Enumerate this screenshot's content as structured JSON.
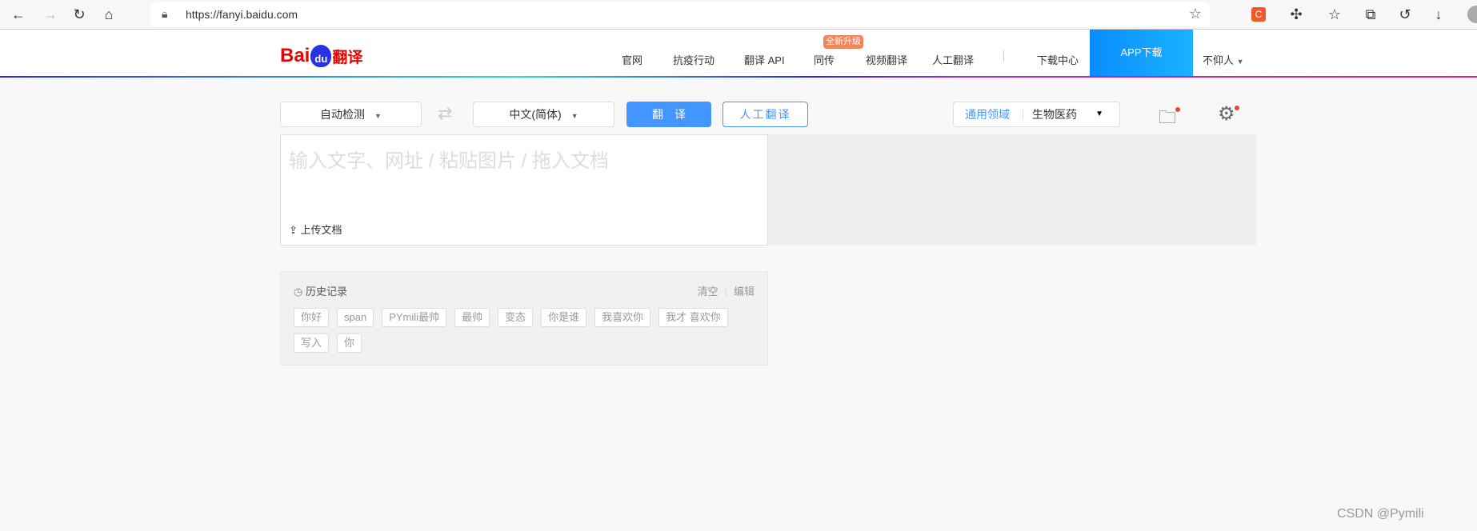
{
  "browser": {
    "url": "https://fanyi.baidu.com",
    "extension_label": "C"
  },
  "header": {
    "logo_bai": "Bai",
    "logo_du": "du",
    "logo_fanyi": "翻译",
    "nav": [
      "官网",
      "抗疫行动",
      "翻译 API",
      "同传",
      "视频翻译",
      "人工翻译",
      "下载中心"
    ],
    "badge": "全新升级",
    "app_download": "APP下载",
    "user": "不仰人"
  },
  "toolbar": {
    "source_lang": "自动检测",
    "target_lang": "中文(简体)",
    "translate": "翻译",
    "human_translate": "人工翻译",
    "domain_general": "通用领域",
    "domain_selected": "生物医药"
  },
  "input": {
    "placeholder": "输入文字、网址 / 粘贴图片 / 拖入文档",
    "upload": "上传文档"
  },
  "history": {
    "title": "历史记录",
    "clear": "清空",
    "edit": "编辑",
    "items": [
      "你好",
      "span",
      "PYmili最帅",
      "最帅",
      "变态",
      "你是谁",
      "我喜欢你",
      "我才 喜欢你",
      "写入",
      "你"
    ]
  },
  "watermark": "CSDN @Pymili",
  "colors": {
    "accent": "#4395ff",
    "brand_red": "#e10602",
    "brand_blue": "#2932e1",
    "badge": "#f0855a"
  }
}
